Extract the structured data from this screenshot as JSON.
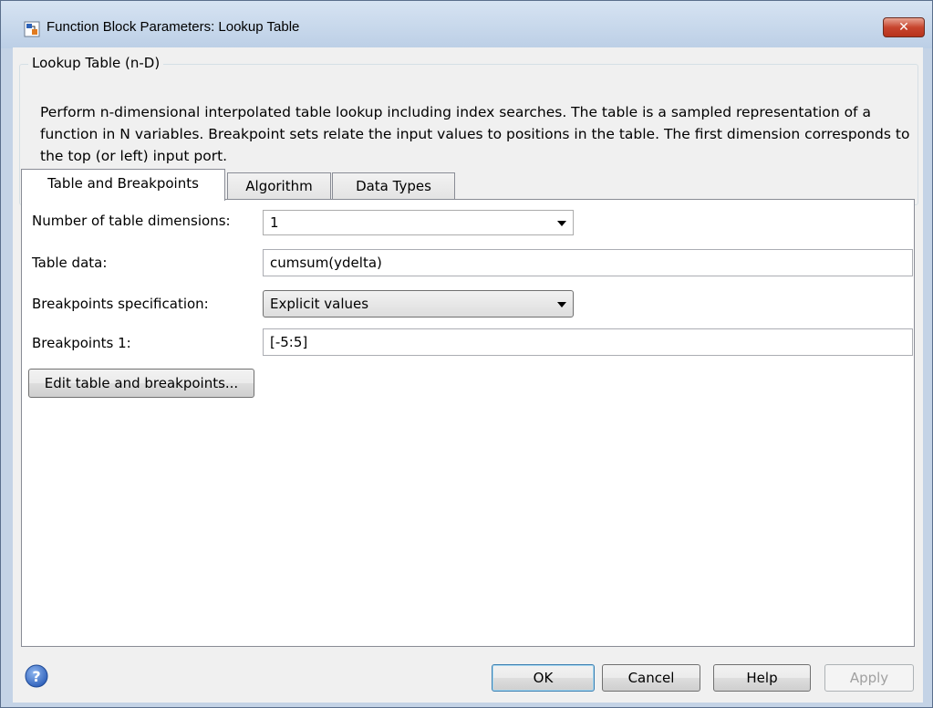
{
  "window": {
    "title": "Function Block Parameters: Lookup Table",
    "close_glyph": "✕"
  },
  "block": {
    "group_label": "Lookup Table (n-D)",
    "description": "Perform n-dimensional interpolated table lookup including index searches. The table is a sampled representation of a function in N variables. Breakpoint sets relate the input values to positions in the table. The first dimension corresponds to the top (or left) input port."
  },
  "tabs": [
    {
      "label": "Table and Breakpoints",
      "active": true
    },
    {
      "label": "Algorithm",
      "active": false
    },
    {
      "label": "Data Types",
      "active": false
    }
  ],
  "form": {
    "dimensions_label": "Number of table dimensions:",
    "dimensions_value": "1",
    "table_data_label": "Table data:",
    "table_data_value": "cumsum(ydelta)",
    "bp_spec_label": "Breakpoints specification:",
    "bp_spec_value": "Explicit values",
    "bp1_label": "Breakpoints 1:",
    "bp1_value": "[-5:5]",
    "edit_button": "Edit table and breakpoints..."
  },
  "buttons": {
    "ok": "OK",
    "cancel": "Cancel",
    "help": "Help",
    "apply": "Apply"
  },
  "icons": {
    "app": "simulink-block-icon",
    "help": "help-question-icon",
    "dropdown": "dropdown-arrow-icon"
  },
  "colors": {
    "titlebar": "#c4d3e6",
    "close_button": "#c7452e",
    "client_bg": "#f0f0f0",
    "help_icon": "#3a6fc4"
  }
}
